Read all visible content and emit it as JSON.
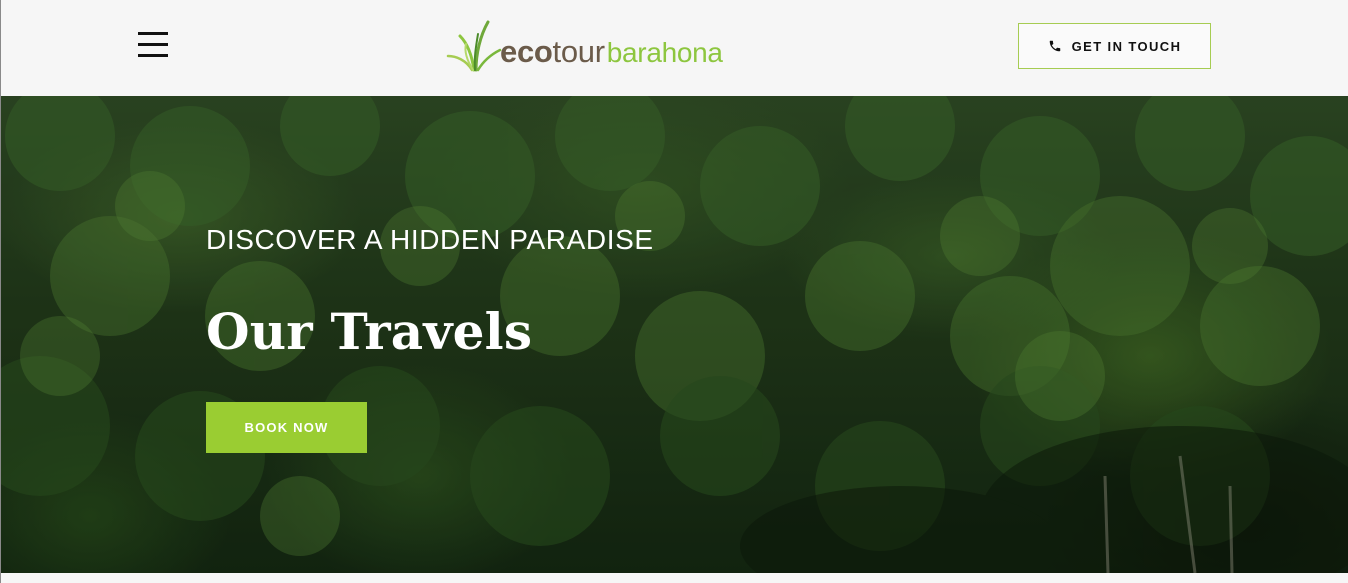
{
  "header": {
    "menu_icon": "hamburger-menu-icon",
    "logo": {
      "part1": "eco",
      "part2": "tour",
      "part3": "barahona",
      "icon": "grass-leaves-icon"
    },
    "contact_button": {
      "label": "GET IN TOUCH",
      "icon": "phone-icon"
    }
  },
  "hero": {
    "eyebrow": "DISCOVER A HIDDEN PARADISE",
    "title": "Our Travels",
    "cta_label": "BOOK NOW",
    "background": "forest-canopy-photo"
  },
  "colors": {
    "accent_green": "#9acd32",
    "logo_brown": "#6b5b4a",
    "logo_green": "#8dc63f",
    "header_bg": "#f6f6f6",
    "contact_border": "#a6cc52"
  }
}
